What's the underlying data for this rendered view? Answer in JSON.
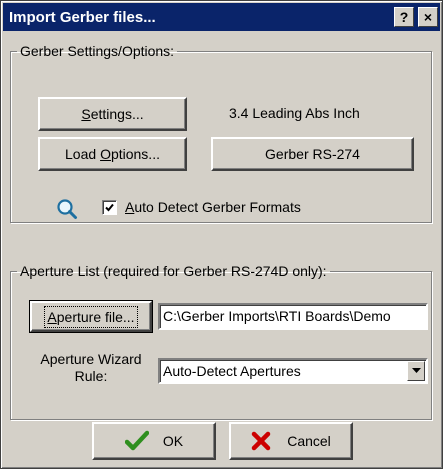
{
  "window": {
    "title": "Import Gerber files...",
    "help_glyph": "?",
    "close_glyph": "×"
  },
  "gerber_group": {
    "legend": "Gerber Settings/Options:",
    "settings_button": {
      "mnemonic": "S",
      "rest": "ettings..."
    },
    "format_text": "3.4 Leading Abs Inch",
    "load_options_button": {
      "before": "Load ",
      "mnemonic": "O",
      "rest": "ptions..."
    },
    "gerber_type_button": "Gerber RS-274",
    "search_icon": "magnifier-icon",
    "auto_detect": {
      "checked": true,
      "mnemonic": "A",
      "rest": "uto Detect Gerber Formats"
    }
  },
  "aperture_group": {
    "legend": "Aperture List (required for Gerber RS-274D only):",
    "aperture_file_button": {
      "mnemonic": "A",
      "rest": "perture file..."
    },
    "aperture_path": "C:\\Gerber Imports\\RTI Boards\\Demo",
    "wizard_label_line1": "Aperture Wizard",
    "wizard_label_line2": "Rule:",
    "wizard_rule_value": "Auto-Detect Apertures"
  },
  "footer": {
    "ok_label": "OK",
    "cancel_label": "Cancel"
  },
  "colors": {
    "face": "#d4d0c8",
    "title_bar": "#0a246a",
    "ok_check": "#2f8f1f",
    "cancel_x": "#cc0000"
  }
}
